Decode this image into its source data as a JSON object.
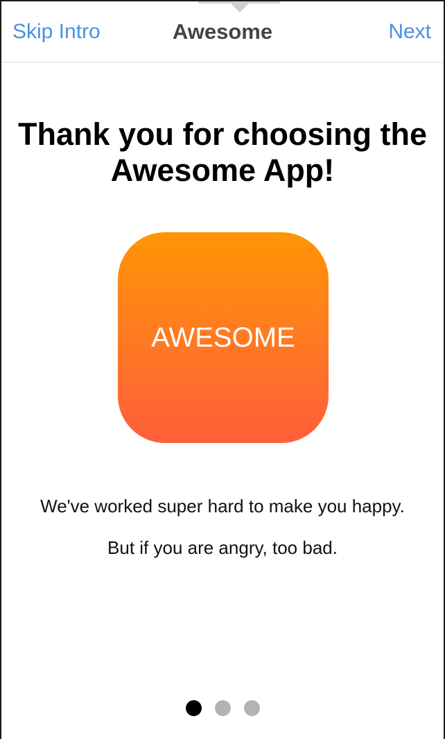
{
  "navbar": {
    "left_label": "Skip Intro",
    "title": "Awesome",
    "right_label": "Next"
  },
  "content": {
    "headline": "Thank you for choosing the Awesome App!",
    "app_icon_label": "AWESOME",
    "line1": "We've worked super hard to make you happy.",
    "line2": "But if you are angry, too bad."
  },
  "pager": {
    "total_pages": 3,
    "current_page": 1
  },
  "colors": {
    "link": "#4a90e2",
    "icon_gradient_top": "#ff9505",
    "icon_gradient_bottom": "#ff5e3a",
    "dot_active": "#000000",
    "dot_inactive": "#b3b3b3"
  }
}
